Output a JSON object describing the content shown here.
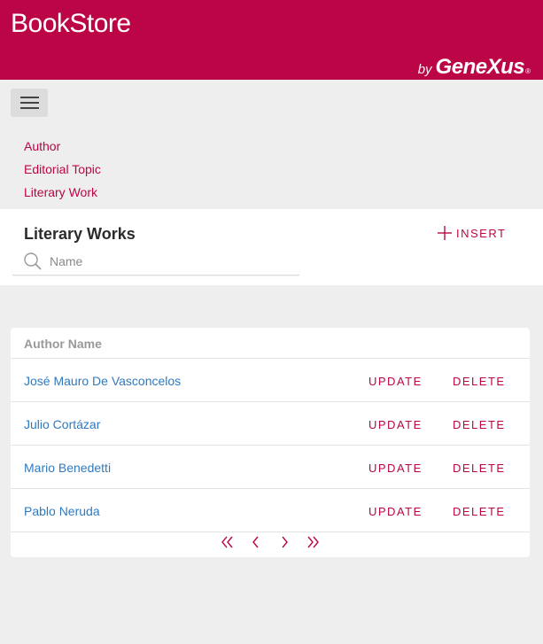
{
  "header": {
    "title": "BookStore",
    "brand_by": "by",
    "brand_name": "GeneXus",
    "brand_mark": "®",
    "color": "#bb0547"
  },
  "nav": {
    "menu_icon": "hamburger-icon",
    "items": [
      {
        "label": "Author"
      },
      {
        "label": "Editorial Topic"
      },
      {
        "label": "Literary Work"
      }
    ]
  },
  "panel": {
    "title": "Literary Works",
    "insert_label": "INSERT",
    "insert_icon": "plus-icon",
    "search": {
      "placeholder": "Name",
      "value": "",
      "icon": "search-icon"
    }
  },
  "grid": {
    "column_header": "Author Name",
    "rows": [
      {
        "name": "José Mauro De Vasconcelos",
        "update": "UPDATE",
        "delete": "DELETE"
      },
      {
        "name": "Julio Cortázar",
        "update": "UPDATE",
        "delete": "DELETE"
      },
      {
        "name": "Mario Benedetti",
        "update": "UPDATE",
        "delete": "DELETE"
      },
      {
        "name": "Pablo Neruda",
        "update": "UPDATE",
        "delete": "DELETE"
      }
    ],
    "pager": [
      "first-page-icon",
      "previous-page-icon",
      "next-page-icon",
      "last-page-icon"
    ],
    "link_color": "#2f7abf"
  }
}
